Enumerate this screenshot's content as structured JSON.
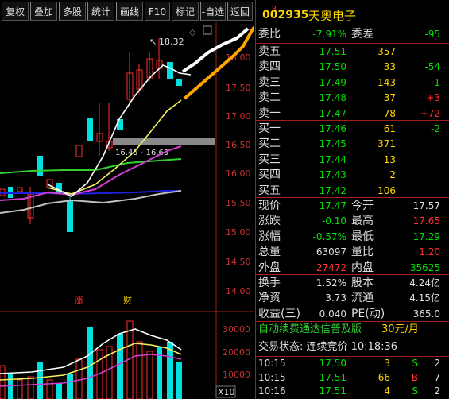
{
  "toolbar": {
    "buttons": [
      "复权",
      "叠加",
      "多股",
      "统计",
      "画线",
      "F10",
      "标记",
      "-自选",
      "返回"
    ]
  },
  "stock": {
    "badge": "R",
    "code": "002935",
    "name": "天奥电子"
  },
  "price_axis": [
    "18.00",
    "17.50",
    "17.00",
    "16.50",
    "16.00",
    "15.50",
    "15.00",
    "14.50",
    "14.00"
  ],
  "volume_axis": [
    "30000",
    "20000",
    "10000"
  ],
  "volume_unit": "X10",
  "annotations": {
    "high_label": "18.32",
    "gap_label": "16.45 - 16.63",
    "marker_zhang": "涨",
    "marker_cai": "财"
  },
  "weibi": {
    "label": "委比",
    "value": "-7.91%",
    "label2": "委差",
    "value2": "-95"
  },
  "sell": [
    {
      "label": "卖五",
      "price": "17.51",
      "vol": "357",
      "chg": ""
    },
    {
      "label": "卖四",
      "price": "17.50",
      "vol": "33",
      "chg": "-54"
    },
    {
      "label": "卖三",
      "price": "17.49",
      "vol": "143",
      "chg": "-1"
    },
    {
      "label": "卖二",
      "price": "17.48",
      "vol": "37",
      "chg": "+3"
    },
    {
      "label": "卖一",
      "price": "17.47",
      "vol": "78",
      "chg": "+72"
    }
  ],
  "buy": [
    {
      "label": "买一",
      "price": "17.46",
      "vol": "61",
      "chg": "-2"
    },
    {
      "label": "买二",
      "price": "17.45",
      "vol": "371",
      "chg": ""
    },
    {
      "label": "买三",
      "price": "17.44",
      "vol": "13",
      "chg": ""
    },
    {
      "label": "买四",
      "price": "17.43",
      "vol": "2",
      "chg": ""
    },
    {
      "label": "买五",
      "price": "17.42",
      "vol": "106",
      "chg": ""
    }
  ],
  "quote": [
    {
      "l1": "现价",
      "v1": "17.47",
      "c1": "green",
      "l2": "今开",
      "v2": "17.57",
      "c2": "white"
    },
    {
      "l1": "涨跌",
      "v1": "-0.10",
      "c1": "green",
      "l2": "最高",
      "v2": "17.65",
      "c2": "red"
    },
    {
      "l1": "涨幅",
      "v1": "-0.57%",
      "c1": "green",
      "l2": "最低",
      "v2": "17.29",
      "c2": "green"
    },
    {
      "l1": "总量",
      "v1": "63097",
      "c1": "white",
      "l2": "量比",
      "v2": "1.20",
      "c2": "red"
    },
    {
      "l1": "外盘",
      "v1": "27472",
      "c1": "red",
      "l2": "内盘",
      "v2": "35625",
      "c2": "green"
    }
  ],
  "stats": [
    {
      "l1": "换手",
      "v1": "1.52%",
      "l2": "股本",
      "v2": "4.24亿"
    },
    {
      "l1": "净资",
      "v1": "3.73",
      "l2": "流通",
      "v2": "4.15亿"
    },
    {
      "l1": "收益(三)",
      "v1": "0.040",
      "l2": "PE(动)",
      "v2": "365.0"
    }
  ],
  "ad": {
    "text": "自动续费通达信普及版",
    "price": "30元/月"
  },
  "trade_status": "交易状态: 连续竞价 10:18:36",
  "ticks": [
    {
      "time": "10:15",
      "price": "17.50",
      "vol": "3",
      "side": "S",
      "n": "2"
    },
    {
      "time": "10:15",
      "price": "17.51",
      "vol": "66",
      "side": "B",
      "n": "7"
    },
    {
      "time": "10:16",
      "price": "17.51",
      "vol": "4",
      "side": "S",
      "n": "2"
    }
  ],
  "colors": {
    "up": "#ff3030",
    "down": "#00e000",
    "accent_red": "#a02020",
    "text": "#c0c0c0"
  }
}
